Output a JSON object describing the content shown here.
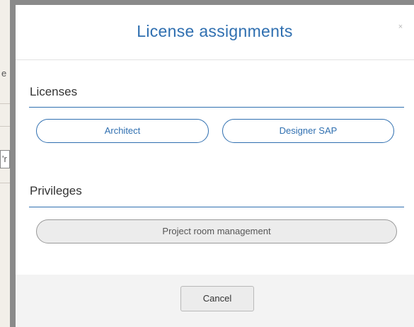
{
  "background": {
    "fragment_1": "e",
    "fragment_2": "'r"
  },
  "dialog": {
    "title": "License assignments",
    "close_symbol": "×"
  },
  "licenses": {
    "heading": "Licenses",
    "items": [
      {
        "label": "Architect"
      },
      {
        "label": "Designer SAP"
      }
    ]
  },
  "privileges": {
    "heading": "Privileges",
    "items": [
      {
        "label": "Project room management"
      }
    ]
  },
  "footer": {
    "cancel_label": "Cancel"
  },
  "colors": {
    "accent": "#2f6fb0",
    "footer_bg": "#f3f3f3",
    "page_bg": "#f2efe9"
  }
}
